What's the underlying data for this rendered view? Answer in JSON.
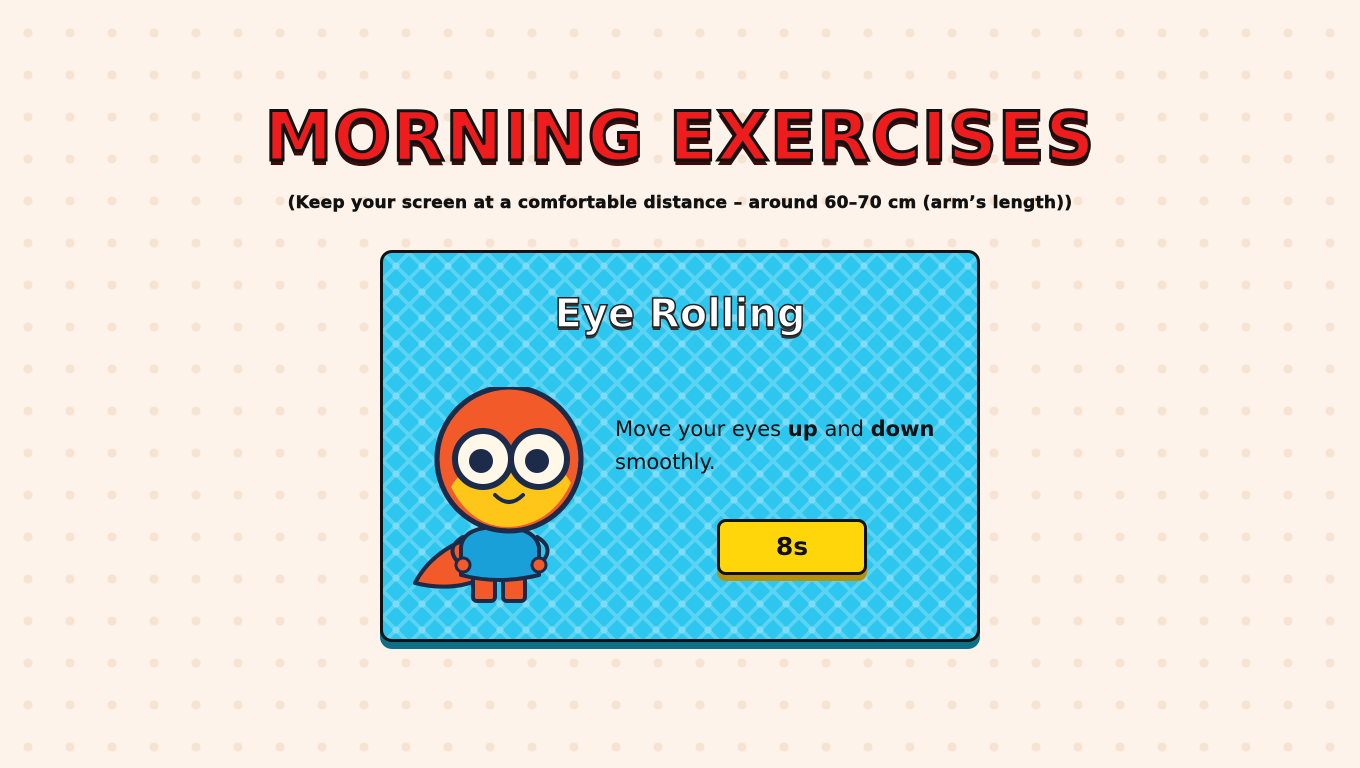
{
  "header": {
    "title": "MORNING EXERCISES",
    "subtitle": "(Keep your screen at a comfortable distance – around 60–70 cm (arm’s length))"
  },
  "exercise": {
    "title": "Eye Rolling",
    "instruction": {
      "part1": "Move your eyes ",
      "bold1": "up",
      "part2": " and ",
      "bold2": "down",
      "part3": " smoothly."
    },
    "timer_label": "8s",
    "mascot_icon": "superhero-mascot-icon"
  },
  "colors": {
    "title_red": "#ee1c1c",
    "card_blue": "#2cc6ee",
    "timer_yellow": "#ffd60a",
    "background": "#fdf3ea"
  }
}
